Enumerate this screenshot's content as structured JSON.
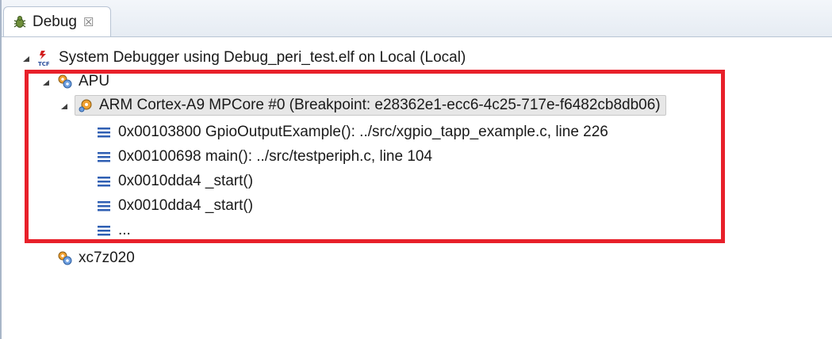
{
  "view": {
    "title": "Debug",
    "close_glyph": "☒"
  },
  "tree": {
    "session": "System Debugger using Debug_peri_test.elf on Local (Local)",
    "apu": "APU",
    "core": "ARM Cortex-A9 MPCore #0 (Breakpoint: e28362e1-ecc6-4c25-717e-f6482cb8db06)",
    "frames": [
      "0x00103800 GpioOutputExample(): ../src/xgpio_tapp_example.c, line 226",
      "0x00100698 main(): ../src/testperiph.c, line 104",
      "0x0010dda4 _start()",
      "0x0010dda4 _start()",
      "..."
    ],
    "fpga": "xc7z020"
  },
  "colors": {
    "highlight": "#e8202a",
    "stack_frame_icon": "#2f5fb3"
  }
}
